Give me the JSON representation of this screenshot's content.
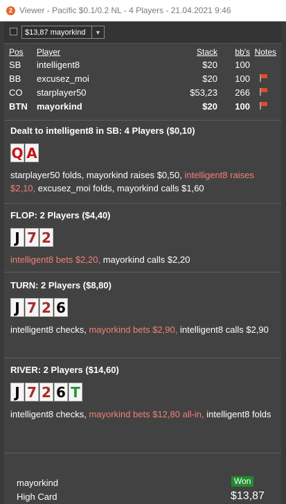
{
  "window": {
    "title": "Viewer - Pacific $0.1/0.2 NL - 4 Players - 21.04.2021 9:46",
    "icon_text": "2"
  },
  "toolbar": {
    "selected_hand": "$13,87 mayorkind"
  },
  "players_table": {
    "headers": {
      "pos": "Pos",
      "player": "Player",
      "stack": "Stack",
      "bbs": "bb's",
      "notes": "Notes"
    },
    "rows": [
      {
        "pos": "SB",
        "player": "intelligent8",
        "stack": "$20",
        "bbs": "100",
        "flag": false
      },
      {
        "pos": "BB",
        "player": "excusez_moi",
        "stack": "$20",
        "bbs": "100",
        "flag": true
      },
      {
        "pos": "CO",
        "player": "starplayer50",
        "stack": "$53,23",
        "bbs": "266",
        "flag": true
      },
      {
        "pos": "BTN",
        "player": "mayorkind",
        "stack": "$20",
        "bbs": "100",
        "flag": true
      }
    ]
  },
  "preflop": {
    "header": "Dealt to intelligent8 in SB: 4 Players ($0,10)",
    "cards": [
      "Q",
      "A"
    ],
    "action": {
      "p1": "starplayer50 folds, mayorkind raises $0,50, ",
      "p2": "intelligent8 raises $2,10,",
      "p3": " excusez_moi folds, mayorkind calls $1,60"
    }
  },
  "flop": {
    "header": "FLOP: 2 Players ($4,40)",
    "cards": [
      "J",
      "7",
      "2"
    ],
    "action": {
      "p1": "intelligent8 bets $2,20,",
      "p2": " mayorkind calls $2,20"
    }
  },
  "turn": {
    "header": "TURN: 2 Players ($8,80)",
    "cards": [
      "J",
      "7",
      "2",
      "6"
    ],
    "action": {
      "p1": "intelligent8 checks, ",
      "p2": "mayorkind bets $2,90,",
      "p3": " intelligent8 calls $2,90"
    }
  },
  "river": {
    "header": "RIVER: 2 Players ($14,60)",
    "cards": [
      "J",
      "7",
      "2",
      "6",
      "T"
    ],
    "action": {
      "p1": "intelligent8 checks, ",
      "p2": "mayorkind bets $12,80 all-in,",
      "p3": " intelligent8 folds"
    }
  },
  "result": {
    "winner": "mayorkind",
    "hand": "High Card",
    "badge": "Won",
    "amount": "$13,87"
  },
  "colors": {
    "highlight": "#f0807a",
    "won_badge": "#1f8c2d",
    "card_red": "#c51616",
    "card_green": "#1c9a3c"
  }
}
